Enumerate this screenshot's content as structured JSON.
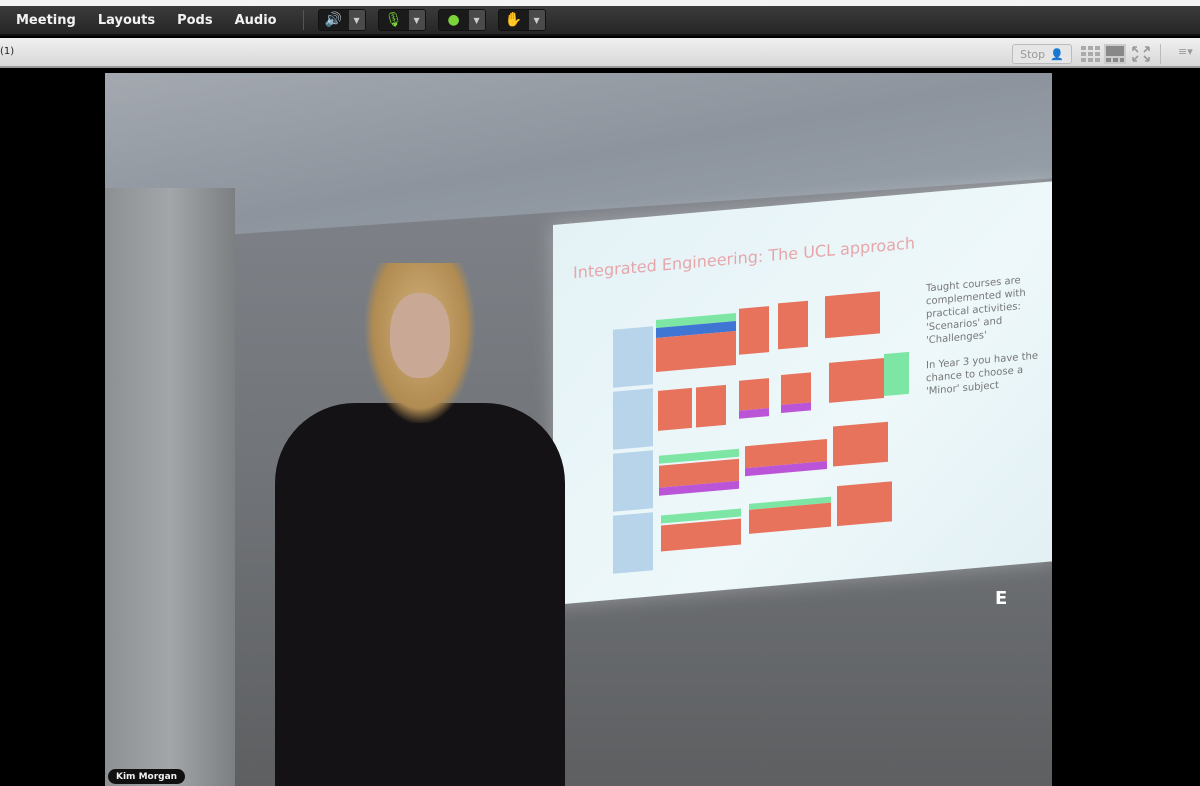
{
  "menubar": {
    "items": [
      "Meeting",
      "Layouts",
      "Pods",
      "Audio"
    ],
    "controls": [
      {
        "icon": "speaker-icon",
        "glyph": "🔊"
      },
      {
        "icon": "microphone-icon",
        "glyph": "🎙"
      },
      {
        "icon": "webcam-icon",
        "glyph": "●"
      },
      {
        "icon": "raise-hand-icon",
        "glyph": "✋"
      }
    ]
  },
  "pod": {
    "title": "(1)",
    "stop_label": "Stop"
  },
  "video": {
    "presenter_name": "Kim Morgan",
    "slide_title": "Integrated Engineering: The UCL approach",
    "slide_text": [
      "Taught courses are complemented with practical activities: 'Scenarios' and 'Challenges'",
      "In Year 3 you have the chance to choose a 'Minor' subject"
    ]
  },
  "colors": {
    "accent": "#7cd43a",
    "toolbar": "#2e2e2e"
  }
}
